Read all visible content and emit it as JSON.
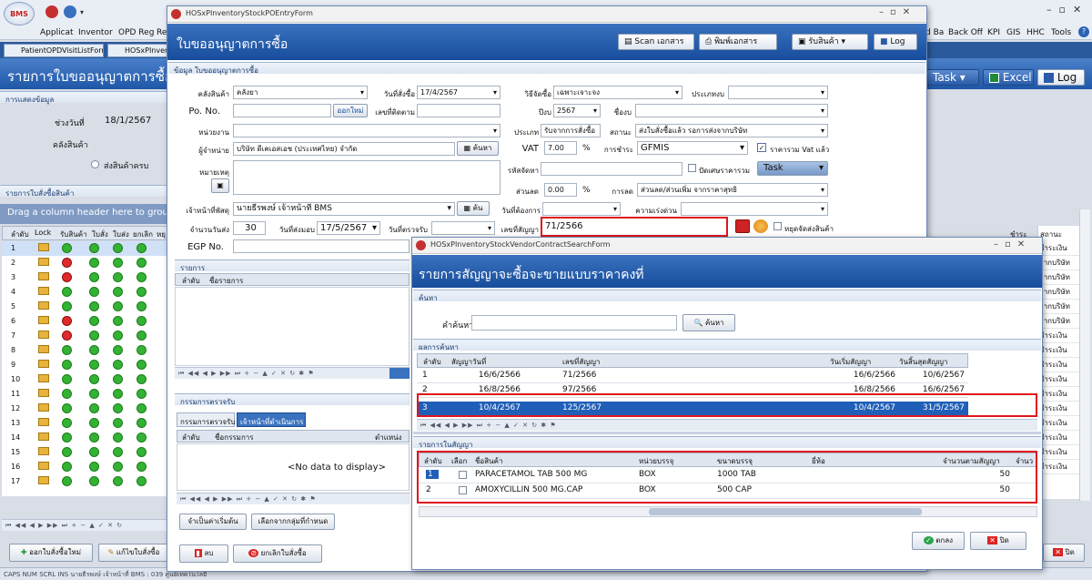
{
  "app": {
    "menu": [
      "Applicat",
      "Inventor",
      "OPD Reg",
      "Re"
    ],
    "right_menu": [
      "d Ba",
      "Back Off",
      "KPI",
      "GIS",
      "HHC",
      "Tools"
    ],
    "doc_tabs": [
      "PatientOPDVisitListForm",
      "HOSxPInven"
    ],
    "logo": "BMS"
  },
  "main": {
    "title": "รายการใบขออนุญาตการซื้อ",
    "section_display": "การแสดงข้อมูล",
    "date_from_label": "ช่วงวันที่",
    "date_from": "18/1/2567",
    "store_label": "คลังสินค้า",
    "radio_label": "ส่งสินค้าครบ",
    "list_section": "รายการใบสั่งซื้อสินค้า",
    "group_hint": "Drag a column header here to group b",
    "columns": [
      "ลำดับ",
      "Lock",
      "รับสินค้า",
      "ใบสั่ง",
      "ใบส่ง",
      "ยกเลิก",
      "หยุ"
    ],
    "rows": [
      "1",
      "2",
      "3",
      "4",
      "5",
      "6",
      "7",
      "8",
      "9",
      "10",
      "11",
      "12",
      "13",
      "14",
      "15",
      "16",
      "17"
    ],
    "add_button": "ออกใบสั่งซื้อใหม่",
    "edit_button": "แก้ไขใบสั่งซื้อ",
    "task_button": "Task",
    "excel_button": "Excel",
    "log_button": "Log",
    "right_col1": "ชำระ",
    "right_col2": "สถานะ",
    "right_cells": [
      "ชำระเงิน",
      "จากบริษัท",
      "จากบริษัท",
      "จากบริษัท",
      "จากบริษัท",
      "จากบริษัท",
      "ชำระเงิน",
      "ชำระเงิน",
      "ชำระเงิน",
      "ชำระเงิน",
      "ชำระเงิน",
      "ชำระเงิน",
      "ชำระเงิน",
      "ชำระเงิน",
      "ชำระเงิน",
      "ชำระเงิน"
    ],
    "close_button": "ปิด",
    "status": "CAPS  NUM  SCRL  INS   นายธีรพงษ์ เจ้าหน้าที่ BMS : 039 ศูนย์เทคโนโลยี"
  },
  "po": {
    "window_title": "HOSxPInventoryStockPOEntryForm",
    "title": "ใบขออนุญาตการซื้อ",
    "scan": "Scan เอกสาร",
    "print": "พิมพ์เอกสาร",
    "receive": "รับสินค้า",
    "log": "Log",
    "section": "ข้อมูล ใบขออนุญาตการซื้อ",
    "store_label": "คลังสินค้า",
    "store": "คลังยา",
    "order_date_label": "วันที่สั่งซื้อ",
    "order_date": "17/4/2567",
    "method_label": "วิธีจัดซื้อ",
    "method": "เฉพาะเจาะจง",
    "budget_type_label": "ประเภทงบ",
    "po_label": "Po. No.",
    "new_btn": "ออกใหม่",
    "approve_label": "เลขที่ติดตาม",
    "year_label": "ปีงบ",
    "year": "2567",
    "budget_label": "ชื่องบ",
    "unit_label": "หน่วยงาน",
    "type_label": "ประเภท",
    "type": "รับจากการสั่งซื้อ",
    "status_label": "สถานะ",
    "status": "ส่งใบสั่งซื้อแล้ว รอการส่งจากบริษัท",
    "vendor_label": "ผู้จำหน่าย",
    "vendor": "บริษัท ดีเคเอสเอช (ประเทศไทย) จำกัด",
    "search": "ค้นหา",
    "vat_label": "VAT",
    "vat": "7.00",
    "pct": "%",
    "pay_label": "การชำระ",
    "pay": "GFMIS",
    "vat_incl": "ราคารวม Vat แล้ว",
    "note_label": "หมายเหตุ",
    "tax_label": "รหัสจัดหา",
    "round_label": "ปัดเศษราคารวม",
    "task": "Task",
    "discount_label": "ส่วนลด",
    "discount": "0.00",
    "disc_type_label": "การลด",
    "disc_type": "ส่วนลด/ส่วนเพิ่ม จากราคาสุทธิ",
    "officer_label": "เจ้าหน้าที่พัสดุ",
    "officer": "นายธีรพงษ์ เจ้าหน้าที่ BMS",
    "find": "ค้น",
    "need_date_label": "วันที่ต้องการ",
    "urgency_label": "ความเร่งด่วน",
    "days_label": "จำนวนวันส่ง",
    "days": "30",
    "deliver_label": "วันที่ส่งมอบ",
    "deliver": "17/5/2567",
    "check_label": "วันที่ตรวจรับ",
    "contract_label": "เลขที่สัญญา",
    "contract": "71/2566",
    "stop_label": "หยุดจัดส่งสินค้า",
    "egp_label": "EGP No.",
    "items_section": "รายการ",
    "item_cols": [
      "ลำดับ",
      "ชื่อรายการ"
    ],
    "inspect_section": "กรรมการตรวจรับ",
    "inspect_tabs": [
      "กรรมการตรวจรับ",
      "เจ้าหน้าที่ดำเนินการ"
    ],
    "inspect_cols": [
      "ลำดับ",
      "ชื่อกรรมการ",
      "ตำแหน่ง"
    ],
    "no_data": "<No data to display>",
    "default_btn": "จำเป็นค่าเริ่มต้น",
    "group_btn": "เลือกจากกลุ่มที่กำหนด",
    "delete_btn": "ลบ",
    "cancel_btn": "ยกเลิกใบสั่งซื้อ"
  },
  "contract": {
    "window_title": "HOSxPInventoryStockVendorContractSearchForm",
    "title": "รายการสัญญาจะซื้อจะขายแบบราคาคงที่",
    "search_section": "ค้นหา",
    "keyword_label": "คำค้นหา",
    "search_btn": "ค้นหา",
    "result_section": "ผลการค้นหา",
    "cols": [
      "ลำดับ",
      "สัญญาวันที่",
      "เลขที่สัญญา",
      "วันเริ่มสัญญา",
      "วันสิ้นสุดสัญญา"
    ],
    "rows": [
      [
        "1",
        "16/6/2566",
        "71/2566",
        "16/6/2566",
        "10/6/2567"
      ],
      [
        "2",
        "16/8/2566",
        "97/2566",
        "16/8/2566",
        "16/6/2567"
      ],
      [
        "3",
        "10/4/2567",
        "125/2567",
        "10/4/2567",
        "31/5/2567"
      ]
    ],
    "items_section": "รายการในสัญญา",
    "item_cols": [
      "ลำดับ",
      "เลือก",
      "ชื่อสินค้า",
      "หน่วยบรรจุ",
      "ขนาดบรรจุ",
      "ยี่ห้อ",
      "จำนวนตามสัญญา",
      "จำนว"
    ],
    "items": [
      [
        "1",
        "PARACETAMOL TAB 500 MG",
        "BOX",
        "1000 TAB",
        "50"
      ],
      [
        "2",
        "AMOXYCILLIN 500 MG.CAP",
        "BOX",
        "500 CAP",
        "50"
      ]
    ],
    "ok_btn": "ตกลง",
    "close_btn": "ปิด"
  }
}
